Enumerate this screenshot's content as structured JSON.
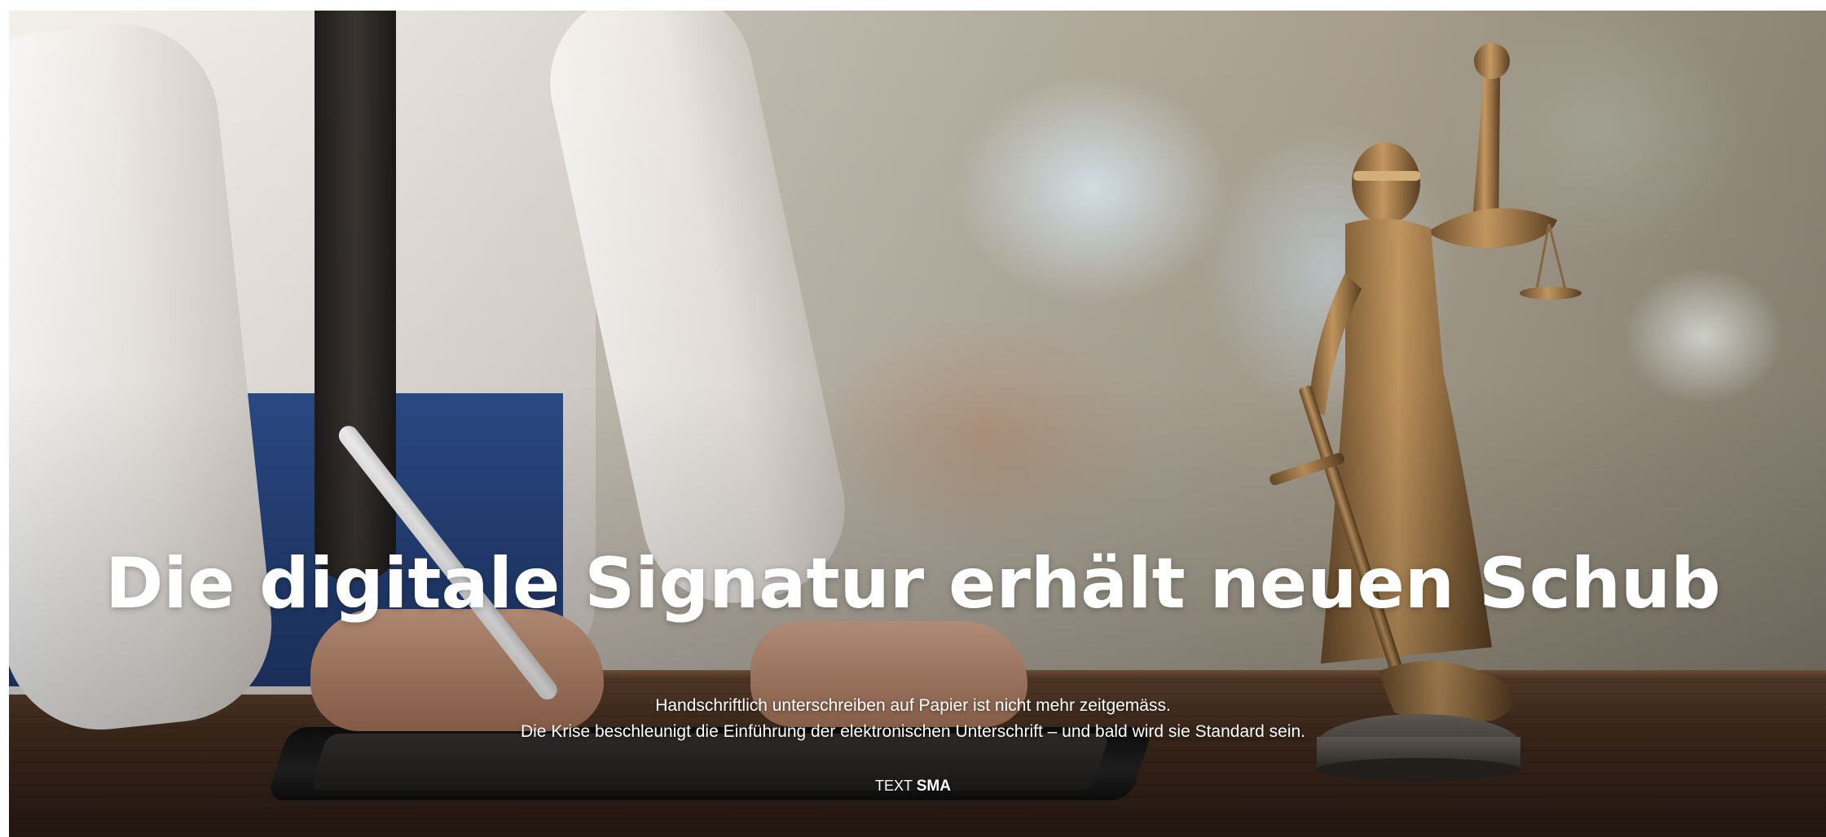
{
  "article": {
    "headline": "Die digitale Signatur erhält neuen Schub",
    "lead_line_1": "Handschriftlich unterschreiben auf Papier ist nicht mehr zeitgemäss.",
    "lead_line_2": "Die Krise beschleunigt die Einführung der elektronischen Unterschrift – und bald wird sie Standard sein.",
    "byline_prefix": "TEXT",
    "byline_author": "SMA"
  },
  "image": {
    "subject": "hand-signing-tablet-with-justice-statue"
  },
  "colors": {
    "text": "#ffffff",
    "background": "#ffffff"
  }
}
